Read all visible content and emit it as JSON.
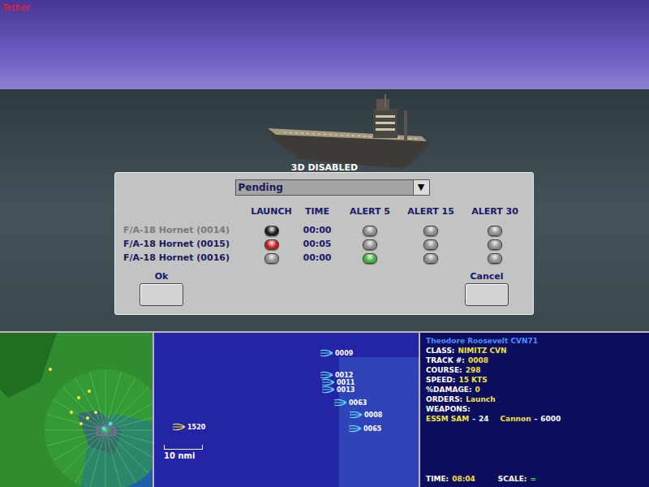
{
  "scene": {
    "label": "Tether",
    "overlay": "3D DISABLED"
  },
  "dialog": {
    "dropdown": {
      "value": "Pending",
      "arrow": "▼"
    },
    "columns": [
      "LAUNCH",
      "TIME",
      "ALERT 5",
      "ALERT 15",
      "ALERT 30"
    ],
    "rows": [
      {
        "name": "F/A-18 Hornet (0014)",
        "disabled": true,
        "time": "00:00",
        "launch": {
          "color": "#1c1c1c"
        },
        "alerts": [
          {
            "color": "#8c8c8c"
          },
          {
            "color": "#8c8c8c"
          },
          {
            "color": "#8c8c8c"
          }
        ]
      },
      {
        "name": "F/A-18 Hornet (0015)",
        "disabled": false,
        "time": "00:05",
        "launch": {
          "color": "#c41a1a"
        },
        "alerts": [
          {
            "color": "#8c8c8c"
          },
          {
            "color": "#8c8c8c"
          },
          {
            "color": "#8c8c8c"
          }
        ]
      },
      {
        "name": "F/A-18 Hornet (0016)",
        "disabled": false,
        "time": "00:00",
        "launch": {
          "color": "#8c8c8c"
        },
        "alerts": [
          {
            "color": "#3fae3a"
          },
          {
            "color": "#8c8c8c"
          },
          {
            "color": "#8c8c8c"
          }
        ]
      }
    ],
    "buttons": [
      {
        "label": "Ok"
      },
      {
        "label": "Cancel"
      }
    ]
  },
  "tactical_map": {
    "tracks": [
      {
        "label": "0009",
        "color": "#5fe0f0"
      },
      {
        "label": "0012",
        "color": "#5fe0f0"
      },
      {
        "label": "0011",
        "color": "#5fe0f0"
      },
      {
        "label": "0013",
        "color": "#5fe0f0"
      },
      {
        "label": "0063",
        "color": "#5fe0f0"
      },
      {
        "label": "0008",
        "color": "#5fe0f0"
      },
      {
        "label": "0065",
        "color": "#5fe0f0"
      },
      {
        "label": "1520",
        "color": "#f0e040"
      }
    ],
    "scale": "10 nmi"
  },
  "info": {
    "name": "Theodore Roosevelt CVN71",
    "fields": [
      {
        "label": "CLASS:",
        "value": "NIMITZ CVN"
      },
      {
        "label": "TRACK #:",
        "value": "0008"
      },
      {
        "label": "COURSE:",
        "value": "298"
      },
      {
        "label": "SPEED:",
        "value": "15 KTS"
      },
      {
        "label": "%DAMAGE:",
        "value": "0"
      },
      {
        "label": "ORDERS:",
        "value": "Launch"
      },
      {
        "label": "WEAPONS:",
        "value": ""
      }
    ],
    "weapons": [
      {
        "name": "ESSM SAM",
        "sep": "-",
        "count": "24"
      },
      {
        "name": "Cannon",
        "sep": "-",
        "count": "6000"
      }
    ],
    "time": {
      "label": "TIME:",
      "value": "08:04"
    },
    "scale": {
      "label": "SCALE:",
      "value": "="
    }
  }
}
